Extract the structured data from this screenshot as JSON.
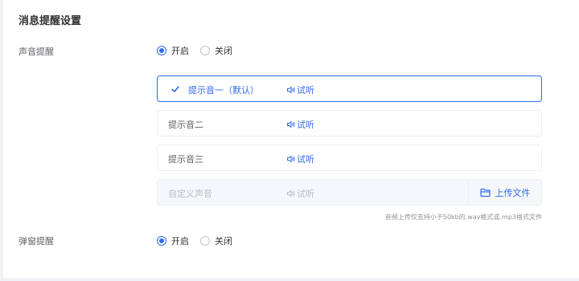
{
  "title": "消息提醒设置",
  "sound": {
    "label": "声音提醒",
    "options": [
      {
        "label": "开启",
        "checked": true
      },
      {
        "label": "关闭",
        "checked": false
      }
    ],
    "list": [
      {
        "name": "提示音一（默认）",
        "listen": "试听",
        "selected": true
      },
      {
        "name": "提示音二",
        "listen": "试听"
      },
      {
        "name": "提示音三",
        "listen": "试听"
      },
      {
        "name": "自定义声音",
        "listen": "试听",
        "disabled": true
      }
    ],
    "upload_label": "上传文件",
    "hint": "音频上传仅支持小于50kb的.wav格式或.mp3格式文件"
  },
  "popup": {
    "label": "弹窗提醒",
    "options": [
      {
        "label": "开启",
        "checked": true
      },
      {
        "label": "关闭",
        "checked": false
      }
    ]
  },
  "colors": {
    "accent": "#2f6bed",
    "border": "#ebeef5",
    "disabled_bg": "#f5f7fa"
  },
  "icons": {
    "selected": "check-icon",
    "listen": "speaker-icon",
    "upload": "folder-icon"
  }
}
